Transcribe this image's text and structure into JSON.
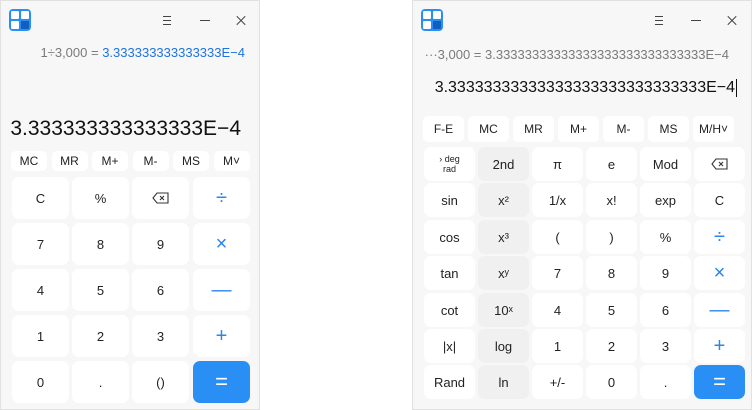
{
  "standard": {
    "expression_left": "1÷3,000 =",
    "expression_result": "3.333333333333333E−4",
    "display": "3.333333333333333E−4",
    "memory": [
      "MC",
      "MR",
      "M+",
      "M-",
      "MS",
      "M˅"
    ],
    "rows": [
      [
        "C",
        "%",
        "⌫",
        "÷"
      ],
      [
        "7",
        "8",
        "9",
        "×"
      ],
      [
        "4",
        "5",
        "6",
        "—"
      ],
      [
        "1",
        "2",
        "3",
        "+"
      ],
      [
        "0",
        ".",
        "()",
        "="
      ]
    ]
  },
  "scientific": {
    "expression": "···3,000 = 3.33333333333333333333333333333E−4",
    "display": "3.33333333333333333333333333333E−4",
    "memory": [
      "F-E",
      "MC",
      "MR",
      "M+",
      "M-",
      "MS",
      "M/H˅"
    ],
    "rows": [
      [
        "> deg rad",
        "2nd",
        "π",
        "e",
        "Mod",
        "⌫"
      ],
      [
        "sin",
        "x²",
        "1/x",
        "x!",
        "exp",
        "C"
      ],
      [
        "cos",
        "x³",
        "(",
        ")",
        "%",
        "÷"
      ],
      [
        "tan",
        "xʸ",
        "7",
        "8",
        "9",
        "×"
      ],
      [
        "cot",
        "10ˣ",
        "4",
        "5",
        "6",
        "—"
      ],
      [
        "|x|",
        "log",
        "1",
        "2",
        "3",
        "+"
      ],
      [
        "Rand",
        "ln",
        "+/-",
        "0",
        ".",
        "="
      ]
    ]
  },
  "colors": {
    "accent": "#2a8ff5",
    "operator": "#2c84ee",
    "background": "#f7f7f7",
    "button": "#ffffff"
  },
  "icons": [
    "calculator-app-icon",
    "menu-icon",
    "minimize-icon",
    "close-icon",
    "backspace-icon"
  ]
}
